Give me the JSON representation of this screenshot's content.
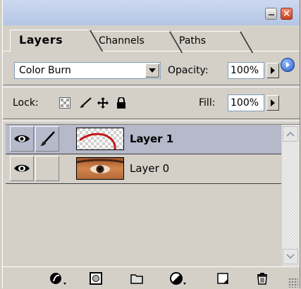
{
  "tabs": [
    {
      "label": "Layers"
    },
    {
      "label": "Channels"
    },
    {
      "label": "Paths"
    }
  ],
  "blend": {
    "mode": "Color Burn"
  },
  "opacity": {
    "label": "Opacity:",
    "value": "100%"
  },
  "lock": {
    "label": "Lock:"
  },
  "fill": {
    "label": "Fill:",
    "value": "100%"
  },
  "layers": [
    {
      "name": "Layer 1",
      "selected": true,
      "visible": true,
      "brush_linked": true
    },
    {
      "name": "Layer 0",
      "selected": false,
      "visible": true,
      "brush_linked": false
    }
  ],
  "icons": {
    "menu": "flyout-menu-icon",
    "lock": [
      "lock-transparency-icon",
      "lock-paint-icon",
      "lock-position-icon",
      "lock-all-icon"
    ],
    "toolbar": [
      "layer-style-icon",
      "layer-mask-icon",
      "new-group-icon",
      "adjustment-layer-icon",
      "new-layer-icon",
      "trash-icon"
    ]
  },
  "colors": {
    "titlebar": "#b4c5e6",
    "selected_row": "#b5b9c9",
    "close_button": "#c9421f"
  }
}
